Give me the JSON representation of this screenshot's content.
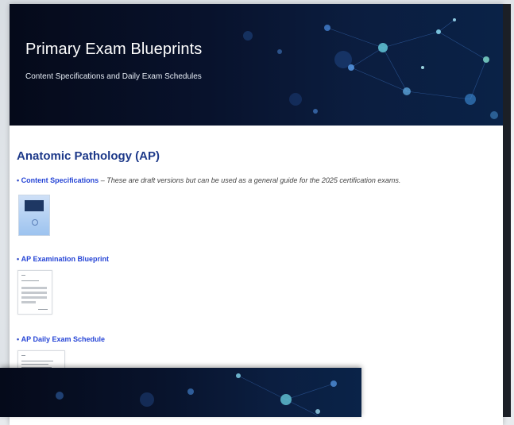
{
  "hero": {
    "title": "Primary Exam Blueprints",
    "subtitle": "Content Specifications and Daily Exam Schedules"
  },
  "section": {
    "title": "Anatomic Pathology (AP)",
    "items": [
      {
        "bullet": "•",
        "link": "Content Specifications",
        "separator": " – ",
        "description": "These are draft versions but can be used as a general guide for the 2025 certification exams."
      },
      {
        "bullet": "•",
        "link": "AP Examination Blueprint"
      },
      {
        "bullet": "•",
        "link": "AP Daily Exam Schedule"
      }
    ]
  },
  "colors": {
    "hero_bg": "#08122c",
    "title_blue": "#1e3a8a",
    "link_blue": "#2645d6"
  },
  "icons": [
    "document-thumbnail-icon",
    "network-graphic"
  ]
}
